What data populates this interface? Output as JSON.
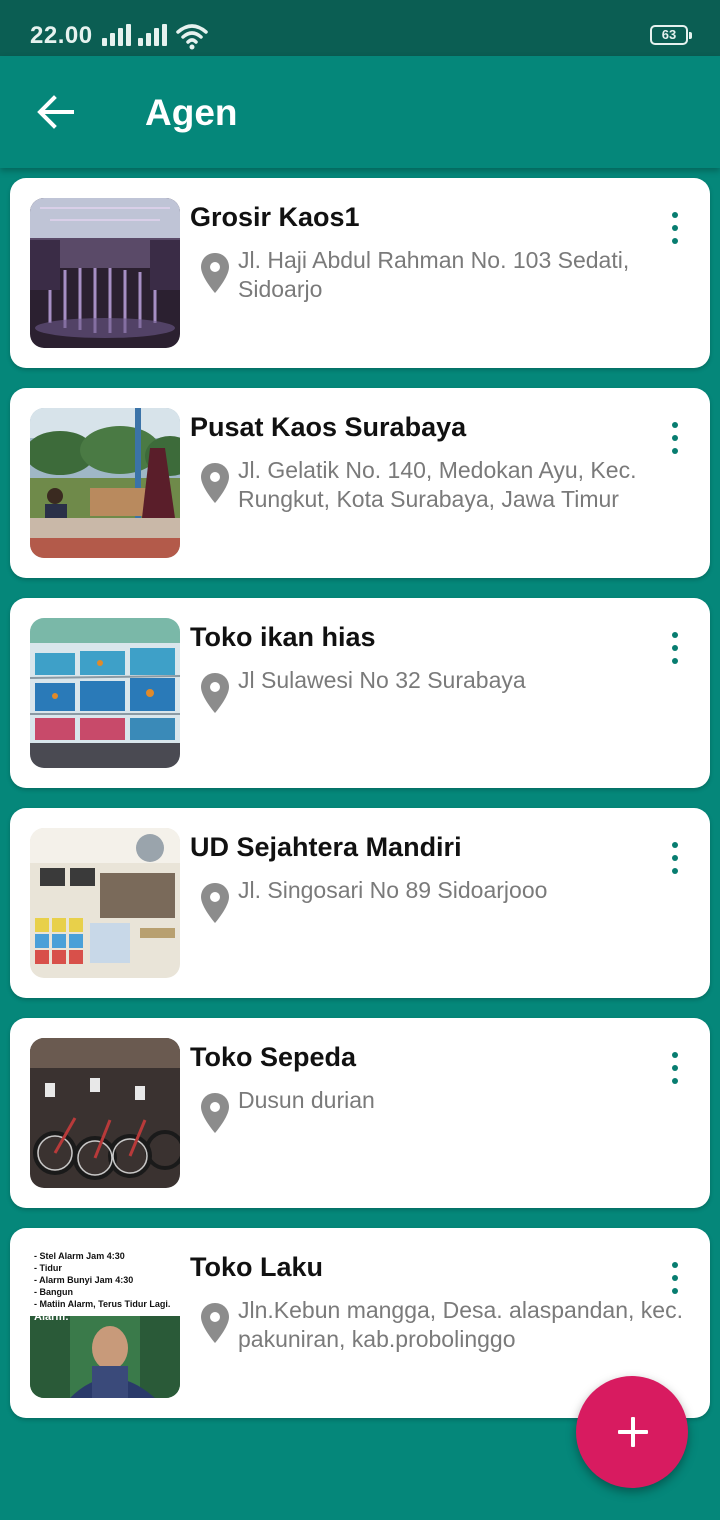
{
  "status_bar": {
    "time": "22.00",
    "battery": "63"
  },
  "app_bar": {
    "title": "Agen"
  },
  "agents": [
    {
      "name": "Grosir Kaos1",
      "address": "Jl. Haji Abdul Rahman No. 103 Sedati, Sidoarjo",
      "image": "clothing-store-photo"
    },
    {
      "name": "Pusat Kaos Surabaya",
      "address": "Jl. Gelatik No. 140, Medokan Ayu, Kec. Rungkut, Kota Surabaya, Jawa Timur",
      "image": "outdoor-stall-photo"
    },
    {
      "name": "Toko ikan hias",
      "address": "Jl Sulawesi No 32 Surabaya",
      "image": "aquarium-shop-photo"
    },
    {
      "name": "UD Sejahtera Mandiri",
      "address": "Jl. Singosari No 89 Sidoarjooo",
      "image": "paint-store-photo"
    },
    {
      "name": "Toko Sepeda",
      "address": "Dusun durian",
      "image": "bicycle-shop-photo"
    },
    {
      "name": "Toko Laku",
      "address": "Jln.Kebun mangga, Desa. alaspandan, kec. pakuniran, kab.probolinggo",
      "image": "meme-photo"
    }
  ],
  "meme_caption": {
    "lines": [
      "- Stel Alarm Jam 4:30",
      "- Tidur",
      "- Alarm Bunyi Jam 4:30",
      "- Bangun",
      "- Matiin Alarm, Terus Tidur Lagi."
    ],
    "label": "Alarm:"
  },
  "icons": {
    "back": "arrow-left-icon",
    "location": "location-pin-icon",
    "more": "more-vert-icon",
    "add": "plus-icon"
  },
  "colors": {
    "primary": "#05877a",
    "status_bar": "#0b5e53",
    "accent": "#d81b60",
    "card": "#ffffff"
  }
}
